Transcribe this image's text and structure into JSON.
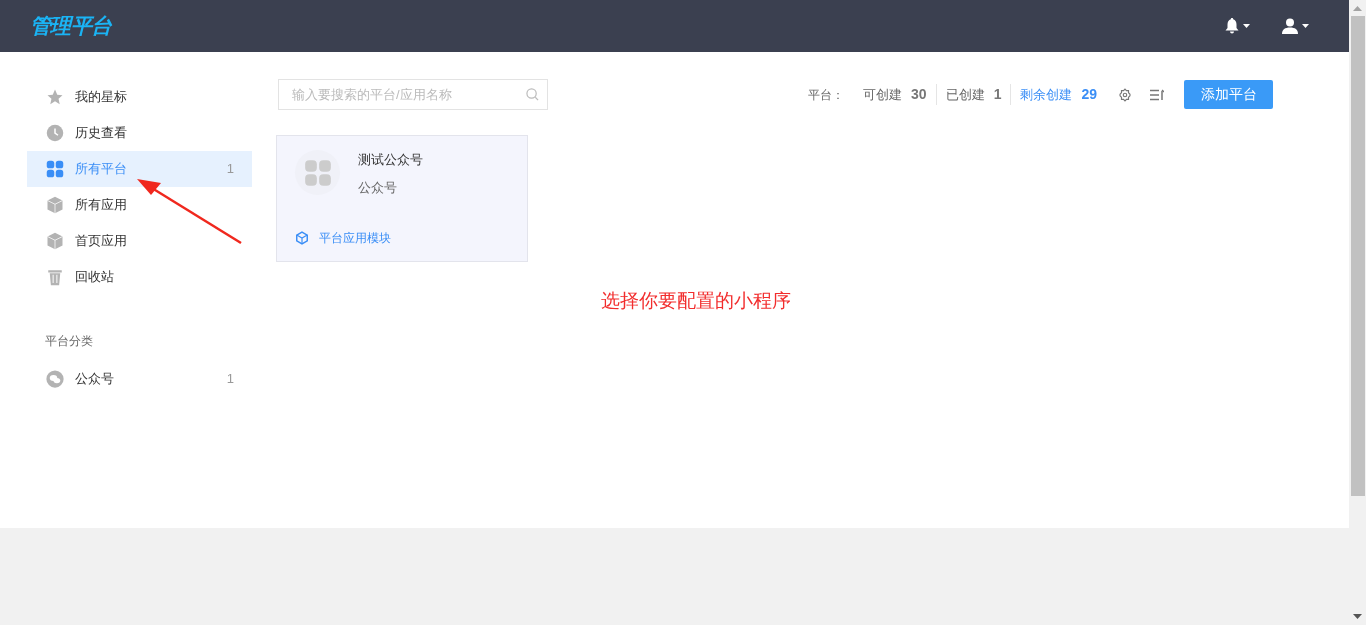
{
  "header": {
    "logo": "管理平台"
  },
  "sidebar": {
    "items": [
      {
        "kind": "star",
        "label": "我的星标",
        "selected": false
      },
      {
        "kind": "clock",
        "label": "历史查看",
        "selected": false
      },
      {
        "kind": "grid",
        "label": "所有平台",
        "count": "1",
        "selected": true
      },
      {
        "kind": "cube",
        "label": "所有应用",
        "selected": false
      },
      {
        "kind": "cube",
        "label": "首页应用",
        "selected": false
      },
      {
        "kind": "trash",
        "label": "回收站",
        "selected": false
      }
    ],
    "section_title": "平台分类",
    "categories": [
      {
        "kind": "chat",
        "label": "公众号",
        "count": "1",
        "selected": false
      }
    ]
  },
  "search": {
    "placeholder": "输入要搜索的平台/应用名称"
  },
  "stats": {
    "label": "平台：",
    "items": [
      {
        "label": "可创建",
        "value": "30",
        "accent": false
      },
      {
        "label": "已创建",
        "value": "1",
        "accent": false
      },
      {
        "label": "剩余创建",
        "value": "29",
        "accent": true
      }
    ]
  },
  "add_button": "添加平台",
  "cards": [
    {
      "name": "测试公众号",
      "type": "公众号",
      "link": "平台应用模块"
    }
  ],
  "annotation": "选择你要配置的小程序"
}
